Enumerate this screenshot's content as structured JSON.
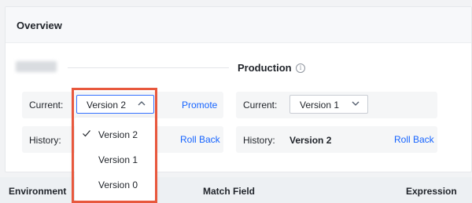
{
  "card": {
    "title": "Overview"
  },
  "environments": {
    "right": {
      "title": "Production",
      "info_icon": "info-circle-icon"
    }
  },
  "left_panel": {
    "current_label": "Current:",
    "current_value": "Version 2",
    "promote": "Promote",
    "history_label": "History:",
    "rollback": "Roll Back"
  },
  "right_panel": {
    "current_label": "Current:",
    "current_value": "Version 1",
    "history_label": "History:",
    "history_value": "Version 2",
    "rollback": "Roll Back"
  },
  "dropdown": {
    "options": [
      {
        "label": "Version 2",
        "selected": true
      },
      {
        "label": "Version 1",
        "selected": false
      },
      {
        "label": "Version 0",
        "selected": false
      }
    ]
  },
  "table": {
    "headers": [
      "Environment",
      "Match Field",
      "Expression"
    ]
  },
  "colors": {
    "link": "#1664ff",
    "focus_border": "#3370ff",
    "highlight_box": "#e8583d"
  }
}
